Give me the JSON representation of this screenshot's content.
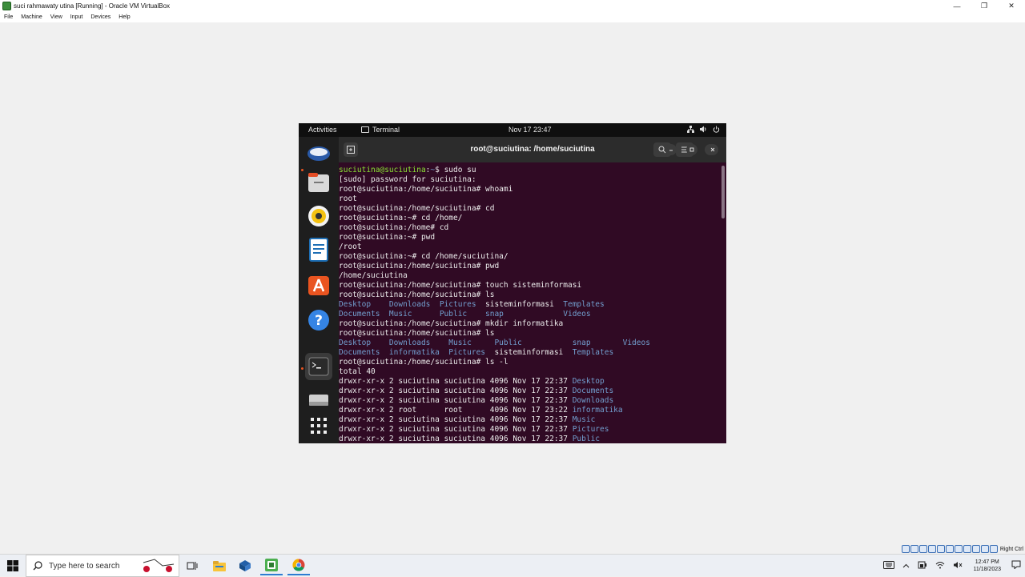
{
  "host": {
    "window_title": "suci rahmawaty utina [Running] - Oracle VM VirtualBox",
    "menu": [
      "File",
      "Machine",
      "View",
      "Input",
      "Devices",
      "Help"
    ],
    "minimize": "—",
    "restore": "❐",
    "close": "✕",
    "host_key": "Right Ctrl"
  },
  "gnome": {
    "activities": "Activities",
    "app_name": "Terminal",
    "clock": "Nov 17  23:47"
  },
  "terminal": {
    "title": "root@suciutina: /home/suciutina",
    "lines": [
      {
        "segments": [
          {
            "text": "suciutina@suciutina",
            "color": "green"
          },
          {
            "text": ":",
            "color": "white"
          },
          {
            "text": "~",
            "color": "blue"
          },
          {
            "text": "$ sudo su",
            "color": "white"
          }
        ]
      },
      {
        "segments": [
          {
            "text": "[sudo] password for suciutina: ",
            "color": "white"
          }
        ]
      },
      {
        "segments": [
          {
            "text": "root@suciutina:/home/suciutina# whoami",
            "color": "white"
          }
        ]
      },
      {
        "segments": [
          {
            "text": "root",
            "color": "white"
          }
        ]
      },
      {
        "segments": [
          {
            "text": "root@suciutina:/home/suciutina# cd",
            "color": "white"
          }
        ]
      },
      {
        "segments": [
          {
            "text": "root@suciutina:~# cd /home/",
            "color": "white"
          }
        ]
      },
      {
        "segments": [
          {
            "text": "root@suciutina:/home# cd",
            "color": "white"
          }
        ]
      },
      {
        "segments": [
          {
            "text": "root@suciutina:~# pwd",
            "color": "white"
          }
        ]
      },
      {
        "segments": [
          {
            "text": "/root",
            "color": "white"
          }
        ]
      },
      {
        "segments": [
          {
            "text": "root@suciutina:~# cd /home/suciutina/",
            "color": "white"
          }
        ]
      },
      {
        "segments": [
          {
            "text": "root@suciutina:/home/suciutina# pwd",
            "color": "white"
          }
        ]
      },
      {
        "segments": [
          {
            "text": "/home/suciutina",
            "color": "white"
          }
        ]
      },
      {
        "segments": [
          {
            "text": "root@suciutina:/home/suciutina# touch sisteminformasi",
            "color": "white"
          }
        ]
      },
      {
        "segments": [
          {
            "text": "root@suciutina:/home/suciutina# ls",
            "color": "white"
          }
        ]
      },
      {
        "segments": [
          {
            "text": "Desktop    Downloads  Pictures  ",
            "color": "blue"
          },
          {
            "text": "sisteminformasi  ",
            "color": "white"
          },
          {
            "text": "Templates",
            "color": "blue"
          }
        ]
      },
      {
        "segments": [
          {
            "text": "Documents  Music      Public    snap             Videos",
            "color": "blue"
          }
        ]
      },
      {
        "segments": [
          {
            "text": "root@suciutina:/home/suciutina# mkdir informatika",
            "color": "white"
          }
        ]
      },
      {
        "segments": [
          {
            "text": "root@suciutina:/home/suciutina# ls",
            "color": "white"
          }
        ]
      },
      {
        "segments": [
          {
            "text": "Desktop    Downloads    Music     Public           snap       Videos",
            "color": "blue"
          }
        ]
      },
      {
        "segments": [
          {
            "text": "Documents  informatika  Pictures  ",
            "color": "blue"
          },
          {
            "text": "sisteminformasi  ",
            "color": "white"
          },
          {
            "text": "Templates",
            "color": "blue"
          }
        ]
      },
      {
        "segments": [
          {
            "text": "root@suciutina:/home/suciutina# ls -l",
            "color": "white"
          }
        ]
      },
      {
        "segments": [
          {
            "text": "total 40",
            "color": "white"
          }
        ]
      },
      {
        "segments": [
          {
            "text": "drwxr-xr-x 2 suciutina suciutina 4096 Nov 17 22:37 ",
            "color": "white"
          },
          {
            "text": "Desktop",
            "color": "blue"
          }
        ]
      },
      {
        "segments": [
          {
            "text": "drwxr-xr-x 2 suciutina suciutina 4096 Nov 17 22:37 ",
            "color": "white"
          },
          {
            "text": "Documents",
            "color": "blue"
          }
        ]
      },
      {
        "segments": [
          {
            "text": "drwxr-xr-x 2 suciutina suciutina 4096 Nov 17 22:37 ",
            "color": "white"
          },
          {
            "text": "Downloads",
            "color": "blue"
          }
        ]
      },
      {
        "segments": [
          {
            "text": "drwxr-xr-x 2 root      root      4096 Nov 17 23:22 ",
            "color": "white"
          },
          {
            "text": "informatika",
            "color": "blue"
          }
        ]
      },
      {
        "segments": [
          {
            "text": "drwxr-xr-x 2 suciutina suciutina 4096 Nov 17 22:37 ",
            "color": "white"
          },
          {
            "text": "Music",
            "color": "blue"
          }
        ]
      },
      {
        "segments": [
          {
            "text": "drwxr-xr-x 2 suciutina suciutina 4096 Nov 17 22:37 ",
            "color": "white"
          },
          {
            "text": "Pictures",
            "color": "blue"
          }
        ]
      },
      {
        "segments": [
          {
            "text": "drwxr-xr-x 2 suciutina suciutina 4096 Nov 17 22:37 ",
            "color": "white"
          },
          {
            "text": "Public",
            "color": "blue"
          }
        ]
      }
    ]
  },
  "taskbar": {
    "search_placeholder": "Type here to search",
    "time": "12:47 PM",
    "date": "11/18/2023"
  },
  "colors": {
    "green": "#8ae234",
    "blue": "#729fcf",
    "white": "#ececec",
    "terminal_bg": "#300a24"
  }
}
